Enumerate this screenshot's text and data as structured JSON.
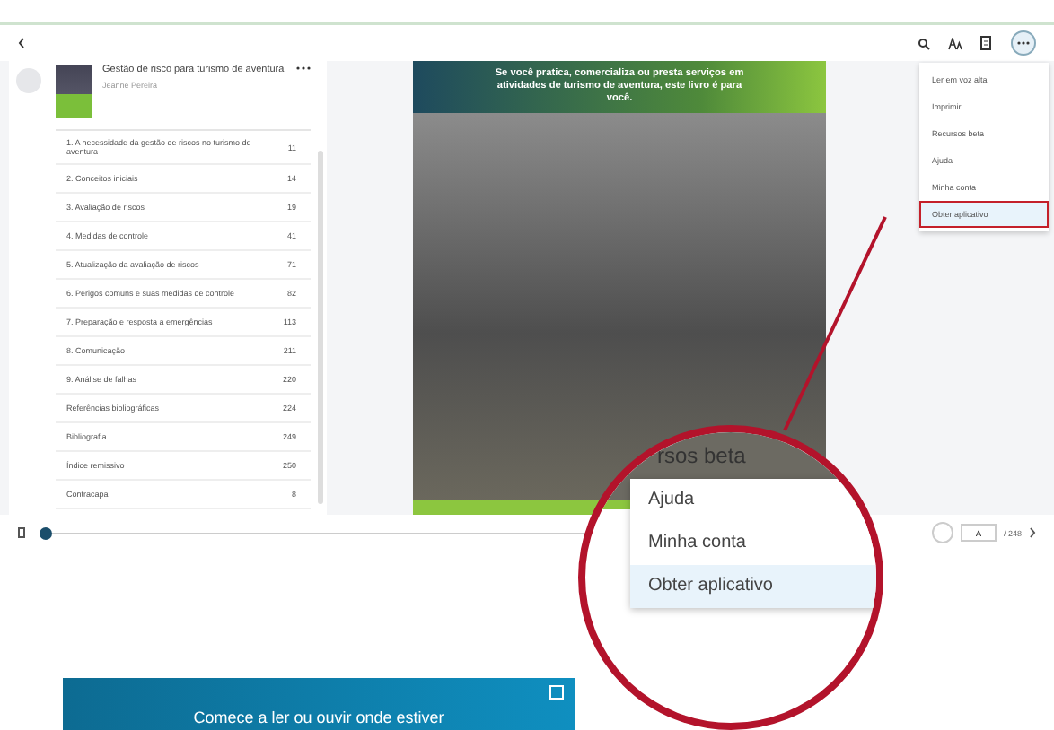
{
  "book": {
    "title": "Gestão de risco para turismo de aventura",
    "author": "Jeanne Pereira"
  },
  "toc": [
    {
      "label": "1. A necessidade da gestão de riscos no turismo de aventura",
      "page": "11"
    },
    {
      "label": "2. Conceitos iniciais",
      "page": "14"
    },
    {
      "label": "3. Avaliação de riscos",
      "page": "19"
    },
    {
      "label": "4. Medidas de controle",
      "page": "41"
    },
    {
      "label": "5. Atualização da avaliação de riscos",
      "page": "71"
    },
    {
      "label": "6. Perigos comuns e suas medidas de controle",
      "page": "82"
    },
    {
      "label": "7. Preparação e resposta a emergências",
      "page": "113"
    },
    {
      "label": "8. Comunicação",
      "page": "211"
    },
    {
      "label": "9. Análise de falhas",
      "page": "220"
    },
    {
      "label": "Referências bibliográficas",
      "page": "224"
    },
    {
      "label": "Bibliografia",
      "page": "249"
    },
    {
      "label": "Índice remissivo",
      "page": "250"
    },
    {
      "label": "Contracapa",
      "page": "8"
    }
  ],
  "page_banner": "Se você pratica, comercializa ou presta serviços em atividades de turismo de aventura, este livro é para você.",
  "menu": [
    {
      "label": "Ler em voz alta",
      "selected": false
    },
    {
      "label": "Imprimir",
      "selected": false
    },
    {
      "label": "Recursos beta",
      "selected": false
    },
    {
      "label": "Ajuda",
      "selected": false
    },
    {
      "label": "Minha conta",
      "selected": false
    },
    {
      "label": "Obter aplicativo",
      "selected": true
    }
  ],
  "magnifier": {
    "partial": "rsos beta",
    "items": [
      {
        "label": "Ajuda",
        "selected": false
      },
      {
        "label": "Minha conta",
        "selected": false
      },
      {
        "label": "Obter aplicativo",
        "selected": true
      }
    ]
  },
  "progress": {
    "level": 0.0
  },
  "pager": {
    "value": "A",
    "total": "/ 248"
  },
  "promo": {
    "text": "Comece a ler ou ouvir onde estiver"
  }
}
